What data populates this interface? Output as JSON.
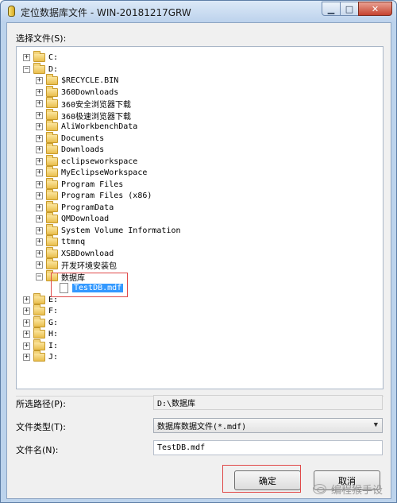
{
  "window": {
    "title": "定位数据库文件 - WIN-20181217GRW",
    "minimize_glyph": "▁",
    "maximize_glyph": "□",
    "close_glyph": "✕"
  },
  "tree": {
    "label": "选择文件(S):",
    "items": [
      {
        "label": "C:",
        "expander": "+"
      },
      {
        "label": "D:",
        "expander": "−"
      },
      {
        "label": "$RECYCLE.BIN",
        "expander": "+"
      },
      {
        "label": "360Downloads",
        "expander": "+"
      },
      {
        "label": "360安全浏览器下载",
        "expander": "+"
      },
      {
        "label": "360极速浏览器下载",
        "expander": "+"
      },
      {
        "label": "AliWorkbenchData",
        "expander": "+"
      },
      {
        "label": "Documents",
        "expander": "+"
      },
      {
        "label": "Downloads",
        "expander": "+"
      },
      {
        "label": "eclipseworkspace",
        "expander": "+"
      },
      {
        "label": "MyEclipseWorkspace",
        "expander": "+"
      },
      {
        "label": "Program Files",
        "expander": "+"
      },
      {
        "label": "Program Files (x86)",
        "expander": "+"
      },
      {
        "label": "ProgramData",
        "expander": "+"
      },
      {
        "label": "QMDownload",
        "expander": "+"
      },
      {
        "label": "System Volume Information",
        "expander": "+"
      },
      {
        "label": "ttmnq",
        "expander": "+"
      },
      {
        "label": "XSBDownload",
        "expander": "+"
      },
      {
        "label": "开发环境安装包",
        "expander": "+"
      },
      {
        "label": "数据库",
        "expander": "−"
      },
      {
        "label": "TestDB.mdf",
        "expander": ""
      },
      {
        "label": "E:",
        "expander": "+"
      },
      {
        "label": "F:",
        "expander": "+"
      },
      {
        "label": "G:",
        "expander": "+"
      },
      {
        "label": "H:",
        "expander": "+"
      },
      {
        "label": "I:",
        "expander": "+"
      },
      {
        "label": "J:",
        "expander": "+"
      }
    ]
  },
  "fields": {
    "path_label": "所选路径(P):",
    "path_value": "D:\\数据库",
    "type_label": "文件类型(T):",
    "type_value": "数据库数据文件(*.mdf)",
    "type_arrow": "▼",
    "name_label": "文件名(N):",
    "name_value": "TestDB.mdf"
  },
  "buttons": {
    "ok": "确定",
    "cancel": "取消"
  },
  "watermark": {
    "text": "编程猴手设"
  },
  "colors": {
    "selection": "#3399ff",
    "highlight_border": "#e04a4a",
    "frame": "#bcd3ec"
  }
}
